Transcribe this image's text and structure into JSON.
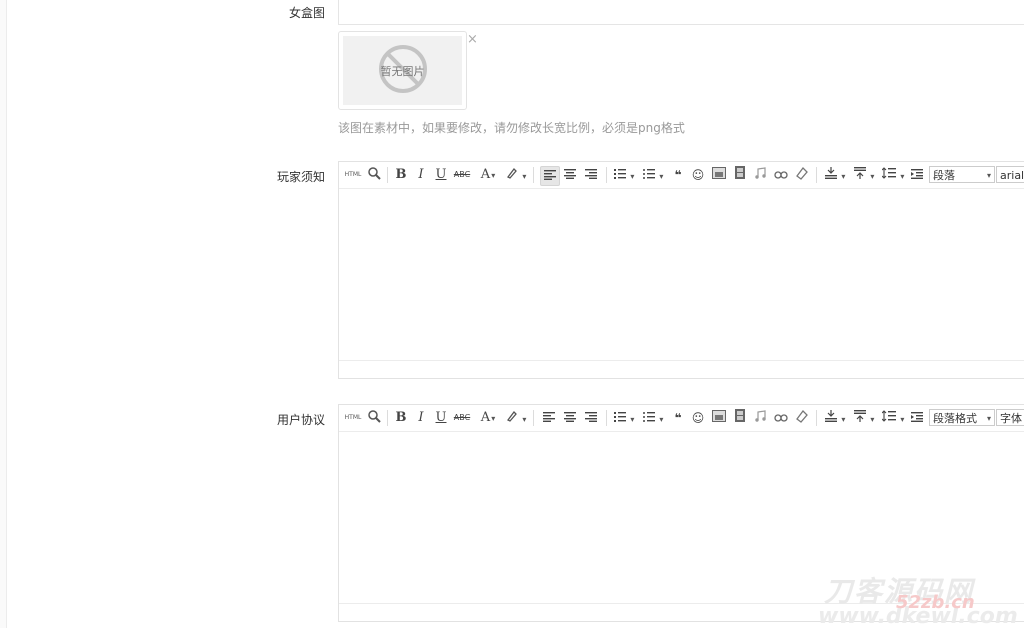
{
  "fields": {
    "box_image": {
      "label": "女盒图"
    },
    "image_placeholder": "暂无图片",
    "image_close": "×",
    "hint": "该图在素材中，如果要修改，请勿修改长宽比例，必须是png格式",
    "player_notice": {
      "label": "玩家须知",
      "paragraph_select": "段落",
      "font_select": "arial"
    },
    "user_agreement": {
      "label": "用户协议",
      "paragraph_select": "段落格式",
      "font_select": "字体"
    }
  },
  "toolbar": {
    "html_label": "HTML",
    "bold": "B",
    "italic": "I",
    "underline": "U",
    "strike": "ABC",
    "font_color": "A",
    "quote": "❝",
    "emoticon": "☺"
  },
  "watermark": {
    "title": "刀客源码网",
    "cn": "52zb.cn",
    "url": "www.dkewl.com"
  },
  "colors": {
    "border": "#e2e2e2",
    "hint": "#999999",
    "active_button": "#e6e6e6"
  }
}
